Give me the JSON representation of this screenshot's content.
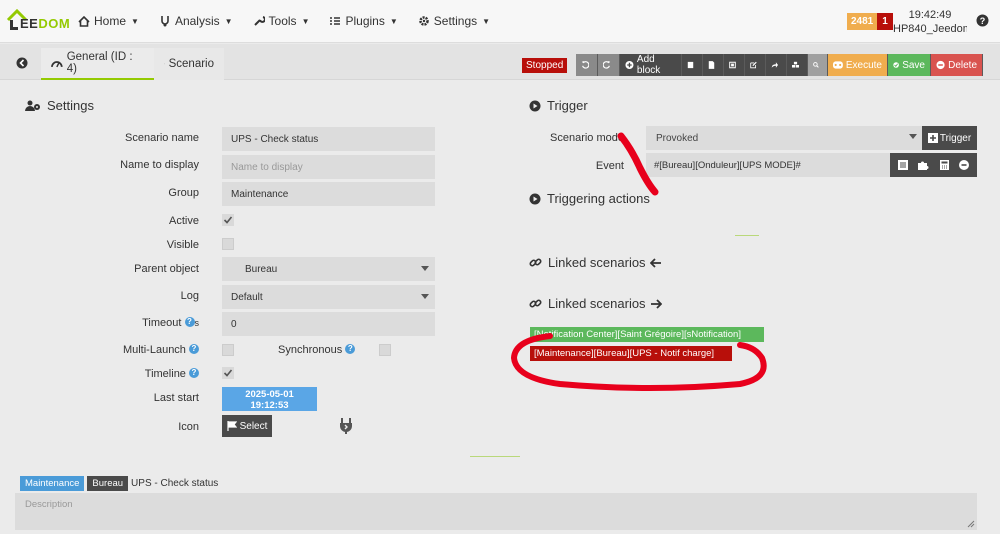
{
  "header": {
    "logo_text_a": "EE",
    "logo_text_b": "DOM",
    "nav": [
      {
        "label": "Home",
        "icon": "home-icon"
      },
      {
        "label": "Analysis",
        "icon": "analysis-icon"
      },
      {
        "label": "Tools",
        "icon": "wrench-icon"
      },
      {
        "label": "Plugins",
        "icon": "plugins-icon"
      },
      {
        "label": "Settings",
        "icon": "gear-icon"
      }
    ],
    "badge_count": "2481",
    "badge_alert": "1",
    "time": "19:42:49",
    "host": "HP840_Jeedom",
    "colors": {
      "accent": "#94ca02",
      "orange": "#f0ad4e",
      "red": "#b80f0a"
    }
  },
  "tabs": {
    "general": "General (ID : 4)",
    "scenario": "Scenario"
  },
  "toolbar": {
    "status": "Stopped",
    "add_block": "Add block",
    "execute": "Execute",
    "save": "Save",
    "delete": "Delete"
  },
  "settings": {
    "title": "Settings",
    "labels": {
      "name": "Scenario name",
      "display": "Name to display",
      "group": "Group",
      "active": "Active",
      "visible": "Visible",
      "parent": "Parent object",
      "log": "Log",
      "timeout": "Timeout",
      "timeout_unit": "s",
      "multilaunch": "Multi-Launch",
      "synchronous": "Synchronous",
      "timeline": "Timeline",
      "last_start": "Last start",
      "icon": "Icon"
    },
    "values": {
      "name": "UPS - Check status",
      "display_placeholder": "Name to display",
      "group": "Maintenance",
      "parent": "Bureau",
      "log": "Default",
      "timeout": "0",
      "last_start_date": "2025-05-01",
      "last_start_time": "19:12:53",
      "select_label": "Select"
    },
    "checkboxes": {
      "active": true,
      "visible": false,
      "multilaunch": false,
      "synchronous": false,
      "timeline": true
    }
  },
  "trigger": {
    "title": "Trigger",
    "mode_label": "Scenario mode",
    "mode_value": "Provoked",
    "trigger_btn": "Trigger",
    "event_label": "Event",
    "event_value": "#[Bureau][Onduleur][UPS MODE]#",
    "triggering_actions": "Triggering actions",
    "linked_in": "Linked scenarios",
    "linked_out": "Linked scenarios",
    "linked_green": "[Notification Center][Saint Grégoire][sNotification]",
    "linked_red": "[Maintenance][Bureau][UPS - Notif charge]"
  },
  "footer": {
    "tag_group": "Maintenance",
    "tag_object": "Bureau",
    "tag_name": "UPS - Check status",
    "description_placeholder": "Description"
  }
}
